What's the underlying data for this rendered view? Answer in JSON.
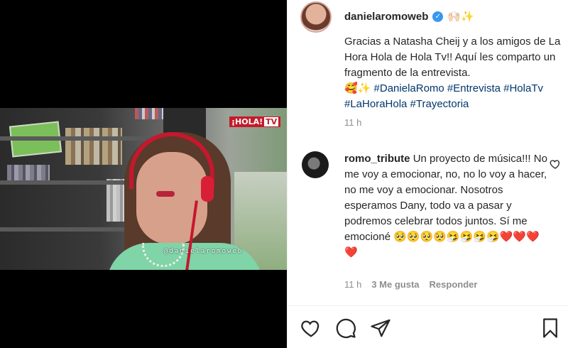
{
  "post": {
    "username": "danielaromoweb",
    "header_emojis": "🙌🏻✨",
    "caption_text": "Gracias a Natasha Cheij y a los amigos de La Hora Hola de Hola Tv!! Aquí les comparto un fragmento de la entrevista.",
    "caption_emojis": "🥰✨",
    "caption_tags": "#DanielaRomo #Entrevista #HolaTv #LaHoraHola #Trayectoria",
    "time": "11 h"
  },
  "media": {
    "badge_main": "¡HOLA!",
    "badge_tv": "TV",
    "watermark": "@danielaromoweb"
  },
  "comment": {
    "username": "romo_tribute",
    "text": "Un proyecto de música!!! No me voy a emocionar, no, no lo voy a hacer, no me voy a emocionar. Nosotros esperamos Dany, todo va a pasar y podremos celebrar todos juntos. Sí me emocioné 🥺🥺🥺🥺🤧🤧🤧🤧❤️❤️❤️❤️",
    "time": "11 h",
    "likes": "3 Me gusta",
    "reply": "Responder"
  },
  "icons": [
    "heart-icon",
    "comment-icon",
    "share-icon",
    "save-icon",
    "verified-icon"
  ],
  "colors": {
    "verified": "#3897f0",
    "hashtag": "#00376b",
    "meta": "#8e8e8e"
  }
}
